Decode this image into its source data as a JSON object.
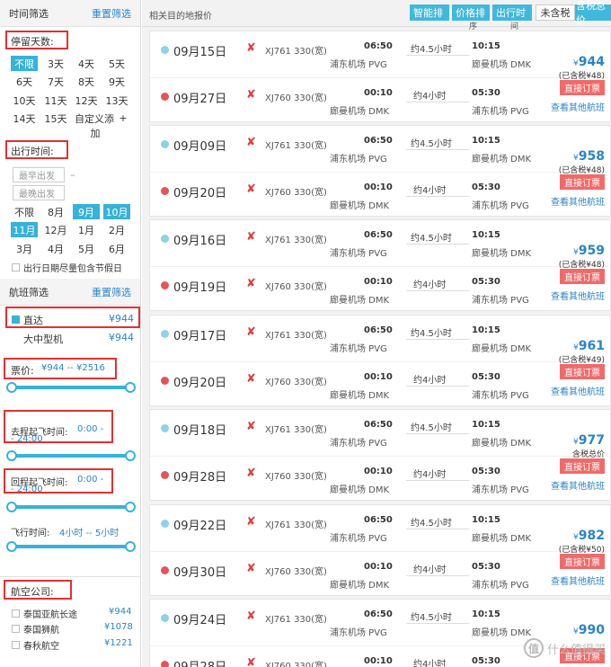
{
  "sidebar": {
    "time_filter_title": "时间筛选",
    "time_reset": "重置筛选",
    "stay_days_label": "停留天数:",
    "stay_days": [
      "不限",
      "3天",
      "4天",
      "5天",
      "6天",
      "7天",
      "8天",
      "9天",
      "10天",
      "11天",
      "12天",
      "13天",
      "14天",
      "15天",
      "自定义添",
      "+",
      "加"
    ],
    "depart_label": "出行时间:",
    "earliest_placeholder": "最早出发",
    "latest_placeholder": "最晚出发",
    "dash": "–",
    "months": [
      "不限",
      "8月",
      "9月",
      "10月",
      "11月",
      "12月",
      "1月",
      "2月",
      "3月",
      "4月",
      "5月",
      "6月"
    ],
    "holiday_label": "出行日期尽量包含节假日",
    "flight_filter_title": "航班筛选",
    "flight_reset": "重置筛选",
    "direct_label": "直达",
    "direct_price": "¥944",
    "bigplane_label": "大中型机",
    "bigplane_price": "¥944",
    "price_label": "票价:",
    "price_range": "¥944 -- ¥2516",
    "out_time_label": "去程起飞时间:",
    "out_time_range_a": "0:00 -",
    "out_time_range_b": "- 24:00",
    "ret_time_label": "回程起飞时间:",
    "ret_time_range_a": "0:00 -",
    "ret_time_range_b": "- 24:00",
    "fly_time_label": "飞行时间:",
    "fly_time_range": "4小时 -- 5小时",
    "airline_label": "航空公司:",
    "airlines": [
      {
        "name": "泰国亚航长途",
        "price": "¥944"
      },
      {
        "name": "泰国狮航",
        "price": "¥1078"
      },
      {
        "name": "春秋航空",
        "price": "¥1221"
      }
    ]
  },
  "main": {
    "title": "相关目的地报价",
    "sort_buttons": [
      "智能排",
      "价格排",
      "出行时"
    ],
    "sort_subs": [
      "",
      "序",
      "间"
    ],
    "tax_buttons": [
      "未含税",
      "含税总价"
    ],
    "cards": [
      {
        "out_date": "09月15日",
        "ret_date": "09月27日",
        "price": "944",
        "tax": "(已含税¥48)",
        "out_dur": "约4.5小时",
        "ret_dur": "约4小时"
      },
      {
        "out_date": "09月09日",
        "ret_date": "09月20日",
        "price": "958",
        "tax": "(已含税¥48)",
        "out_dur": "约4.5小时",
        "ret_dur": "约4小时"
      },
      {
        "out_date": "09月16日",
        "ret_date": "09月19日",
        "price": "959",
        "tax": "(已含税¥48)",
        "out_dur": "约4.5小时",
        "ret_dur": "约4小时"
      },
      {
        "out_date": "09月17日",
        "ret_date": "09月20日",
        "price": "961",
        "tax": "(已含税¥49)",
        "out_dur": "约4.5小时",
        "ret_dur": "约4小时"
      },
      {
        "out_date": "09月18日",
        "ret_date": "09月28日",
        "price": "977",
        "tax": "含税总价",
        "out_dur": "约4.5小时",
        "ret_dur": "约4小时"
      },
      {
        "out_date": "09月22日",
        "ret_date": "09月30日",
        "price": "982",
        "tax": "(已含税¥50)",
        "out_dur": "约4.5小时",
        "ret_dur": "约4小时"
      },
      {
        "out_date": "09月24日",
        "ret_date": "09月28日",
        "price": "990",
        "tax": "",
        "out_dur": "约4.5小时",
        "ret_dur": "约4小时"
      }
    ],
    "out_flight_no": "XJ761 330(宽)",
    "ret_flight_no": "XJ760 330(宽)",
    "out_dep_time": "06:50",
    "out_arr_time": "10:15",
    "out_dep_ap": "浦东机场 PVG",
    "out_arr_ap": "廊曼机场 DMK",
    "ret_dep_time": "00:10",
    "ret_arr_time": "05:30",
    "ret_dep_ap": "廊曼机场 DMK",
    "ret_arr_ap": "浦东机场 PVG",
    "yen": "¥",
    "book_label": "直接订票",
    "others_label": "查看其他航班"
  },
  "watermark": {
    "glyph": "值",
    "text": "什么值得买"
  },
  "colors": {
    "accent": "#37b2d8",
    "link": "#2a84c8",
    "book": "#f06a6a",
    "annotation": "#e23030"
  }
}
